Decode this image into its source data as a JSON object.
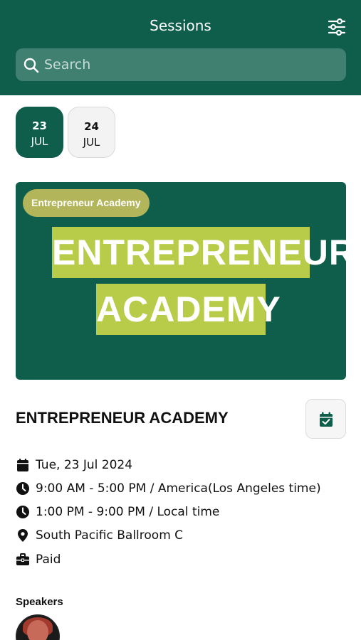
{
  "header": {
    "title": "Sessions",
    "filter_icon": "sliders-icon",
    "search_icon": "search-icon",
    "search_placeholder": "Search"
  },
  "dates": [
    {
      "day": "23",
      "month": "JUL",
      "selected": true
    },
    {
      "day": "24",
      "month": "JUL",
      "selected": false
    }
  ],
  "banner": {
    "tag": "Entrepreneur Academy",
    "line1": "ENTREPRENEUR",
    "line2": "ACADEMY",
    "colors": {
      "background": "#0f5e4b",
      "highlight": "#b8cc4a",
      "tag": "#b2b55a"
    }
  },
  "session": {
    "title": "ENTREPRENEUR ACADEMY",
    "add_to_calendar_icon": "calendar-check-icon",
    "date": "Tue, 23 Jul 2024",
    "time_event": "9:00 AM - 5:00 PM / America(Los Angeles time)",
    "time_local": "1:00 PM - 9:00 PM / Local time",
    "location": "South Pacific Ballroom C",
    "price": "Paid"
  },
  "speakers": {
    "label": "Speakers"
  },
  "colors": {
    "brand": "#0f5e4b",
    "accent": "#b8cc4a"
  }
}
